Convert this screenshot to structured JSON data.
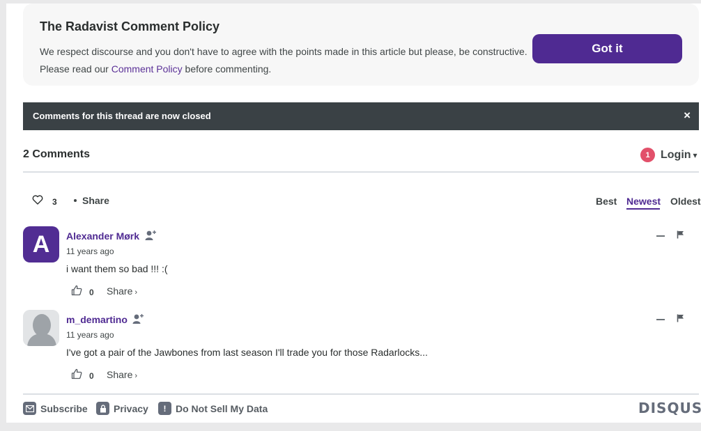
{
  "policy": {
    "title": "The Radavist Comment Policy",
    "text_before": "We respect discourse and you don't have to agree with the points made in this article but please, be constructive. Please read our ",
    "link_text": "Comment Policy",
    "text_after": " before commenting.",
    "button_label": "Got it"
  },
  "banner": {
    "text": "Comments for this thread are now closed",
    "close_label": "×"
  },
  "header": {
    "comment_count": "2 Comments",
    "notification_count": "1",
    "login_label": "Login",
    "login_caret": "▾"
  },
  "toolbar": {
    "like_count": "3",
    "share_label": "Share",
    "sort_options": [
      "Best",
      "Newest",
      "Oldest"
    ],
    "active_sort": "Newest"
  },
  "comments": [
    {
      "avatar_letter": "A",
      "author": "Alexander Mørk",
      "time": "11 years ago",
      "body": "i want them so bad !!! :(",
      "votes": "0",
      "share_label": "Share",
      "share_arrow": "›"
    },
    {
      "avatar_letter": "",
      "author": "m_demartino",
      "time": "11 years ago",
      "body": "I've got a pair of the Jawbones from last season I'll trade you for those Radarlocks...",
      "votes": "0",
      "share_label": "Share",
      "share_arrow": "›"
    }
  ],
  "footer": {
    "subscribe_label": "Subscribe",
    "privacy_label": "Privacy",
    "dnsmd_label": "Do Not Sell My Data",
    "dnsmd_icon_glyph": "!",
    "logo_text": "DISQUS"
  },
  "colors": {
    "accent": "#4f2a92",
    "banner": "#3a4145",
    "badge": "#e2506a"
  },
  "icons": {
    "like": "heart-icon",
    "vote": "thumbs-up-icon",
    "follow": "add-user-icon",
    "flag": "flag-icon",
    "collapse": "minus-icon",
    "subscribe": "envelope-icon",
    "privacy": "lock-icon",
    "dnsmd": "exclamation-icon"
  }
}
